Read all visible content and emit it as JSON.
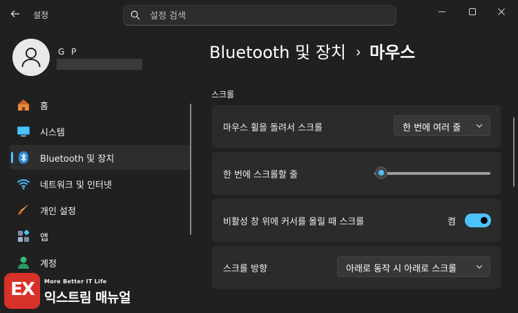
{
  "window": {
    "app_title": "설정",
    "search_placeholder": "설정 검색"
  },
  "profile": {
    "name": "G P"
  },
  "nav": [
    {
      "label": "홈",
      "icon": "home-icon",
      "selected": false
    },
    {
      "label": "시스템",
      "icon": "monitor-icon",
      "selected": false
    },
    {
      "label": "Bluetooth 및 장치",
      "icon": "bluetooth-icon",
      "selected": true
    },
    {
      "label": "네트워크 및 인터넷",
      "icon": "wifi-icon",
      "selected": false
    },
    {
      "label": "개인 설정",
      "icon": "paintbrush-icon",
      "selected": false
    },
    {
      "label": "앱",
      "icon": "apps-icon",
      "selected": false
    },
    {
      "label": "계정",
      "icon": "person-icon",
      "selected": false
    }
  ],
  "breadcrumb": {
    "parent": "Bluetooth 및 장치",
    "separator": "›",
    "current": "마우스"
  },
  "section_title": "스크롤",
  "settings": {
    "wheel_scroll": {
      "label": "마우스 휠을 돌려서 스크롤",
      "value": "한 번에 여러 줄"
    },
    "lines_per_scroll": {
      "label": "한 번에 스크롤할 줄",
      "value_fraction": 0.06
    },
    "inactive_scroll": {
      "label": "비활성 창 위에 커서를 올릴 때 스크롤",
      "state_label": "켬",
      "on": true
    },
    "scroll_direction": {
      "label": "스크롤 방향",
      "value": "아래로 동작 시 아래로 스크롤"
    }
  },
  "watermark": {
    "logo": "EX",
    "tagline": "More Better IT Life",
    "name": "익스트림 매뉴얼"
  },
  "colors": {
    "background": "#202020",
    "card": "#2b2b2b",
    "accent": "#4cc2ff",
    "selected_nav": "#2d2d2d",
    "watermark_red": "#d8312a"
  }
}
